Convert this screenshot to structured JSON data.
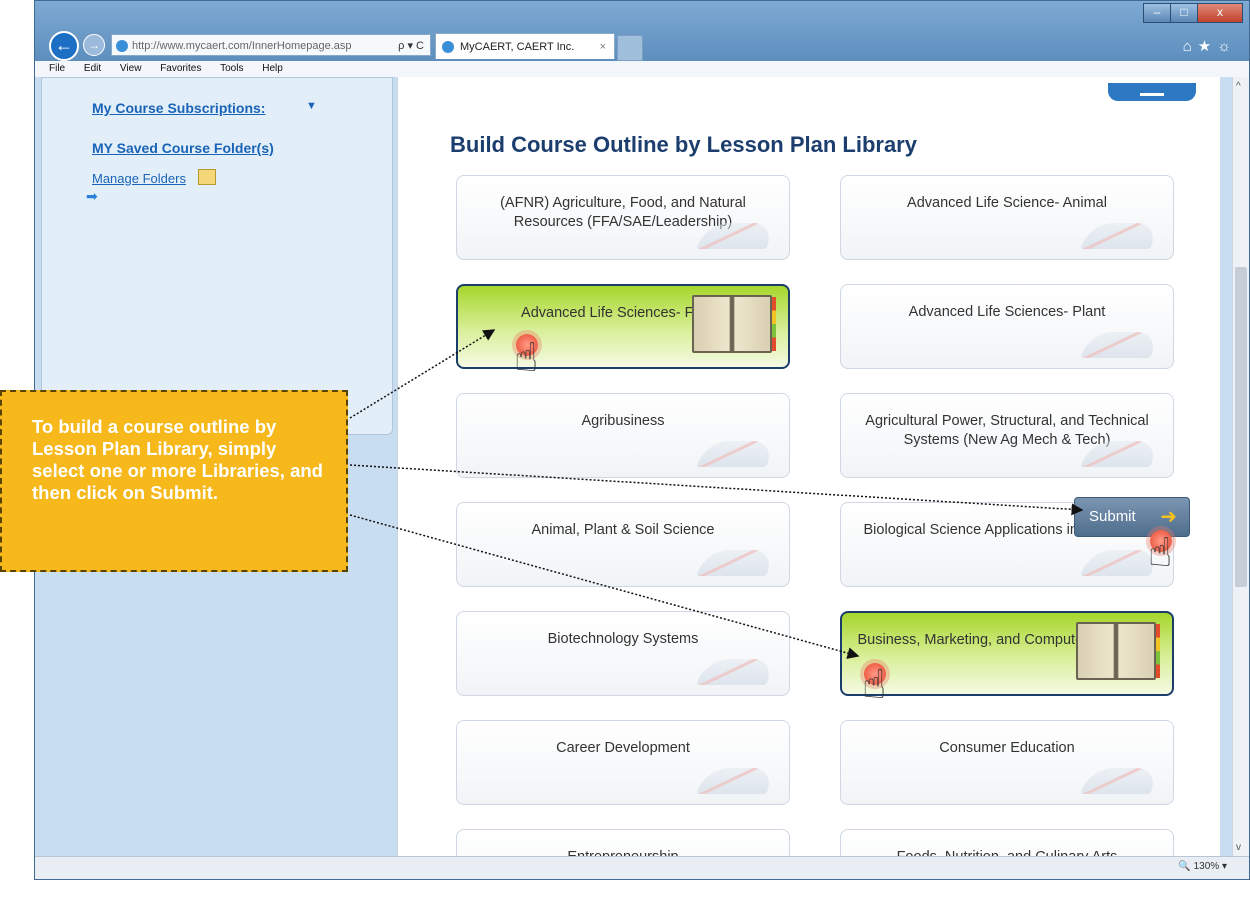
{
  "browser": {
    "address_host": "http://www.mycaert.com",
    "address_path": "/InnerHomepage.asp",
    "address_tools": "ρ ▾ C",
    "tab_title": "MyCAERT, CAERT Inc.",
    "tab_close": "×",
    "right_tools": "⌂★☼",
    "window_buttons": [
      "–",
      "□",
      "x"
    ],
    "zoom": "130%",
    "menu": [
      "File",
      "Edit",
      "View",
      "Favorites",
      "Tools",
      "Help"
    ]
  },
  "sidebar": {
    "subscriptions": "My Course Subscriptions:",
    "saved_folders": "MY Saved Course Folder(s)",
    "manage_folders": "Manage Folders"
  },
  "main": {
    "heading": "Build Course Outline by Lesson Plan Library",
    "cards": [
      {
        "label": "(AFNR) Agriculture, Food, and Natural Resources (FFA/SAE/Leadership)",
        "selected": false
      },
      {
        "label": "Advanced Life Science- Animal",
        "selected": false
      },
      {
        "label": "Advanced Life Sciences- Foods",
        "selected": true
      },
      {
        "label": "Advanced Life Sciences- Plant",
        "selected": false
      },
      {
        "label": "Agribusiness",
        "selected": false
      },
      {
        "label": "Agricultural Power, Structural, and Technical Systems (New Ag Mech & Tech)",
        "selected": false
      },
      {
        "label": "Animal, Plant & Soil Science",
        "selected": false
      },
      {
        "label": "Biological Science Applications in Agriculture",
        "selected": false
      },
      {
        "label": "Biotechnology Systems",
        "selected": false
      },
      {
        "label": "Business, Marketing, and Computer Education",
        "selected": true
      },
      {
        "label": "Career Development",
        "selected": false
      },
      {
        "label": "Consumer Education",
        "selected": false
      },
      {
        "label": "Entrepreneurship",
        "selected": false
      },
      {
        "label": "Foods, Nutrition, and Culinary Arts",
        "selected": false
      }
    ],
    "submit_label": "Submit"
  },
  "callout": {
    "text": "To build a course outline by Lesson Plan Library, simply select one or more Libraries, and then click on Submit."
  },
  "colors": {
    "heading": "#1c3e6e",
    "link": "#1a64b7",
    "selected_card": "#a6d62c",
    "callout": "#f6b81a"
  }
}
